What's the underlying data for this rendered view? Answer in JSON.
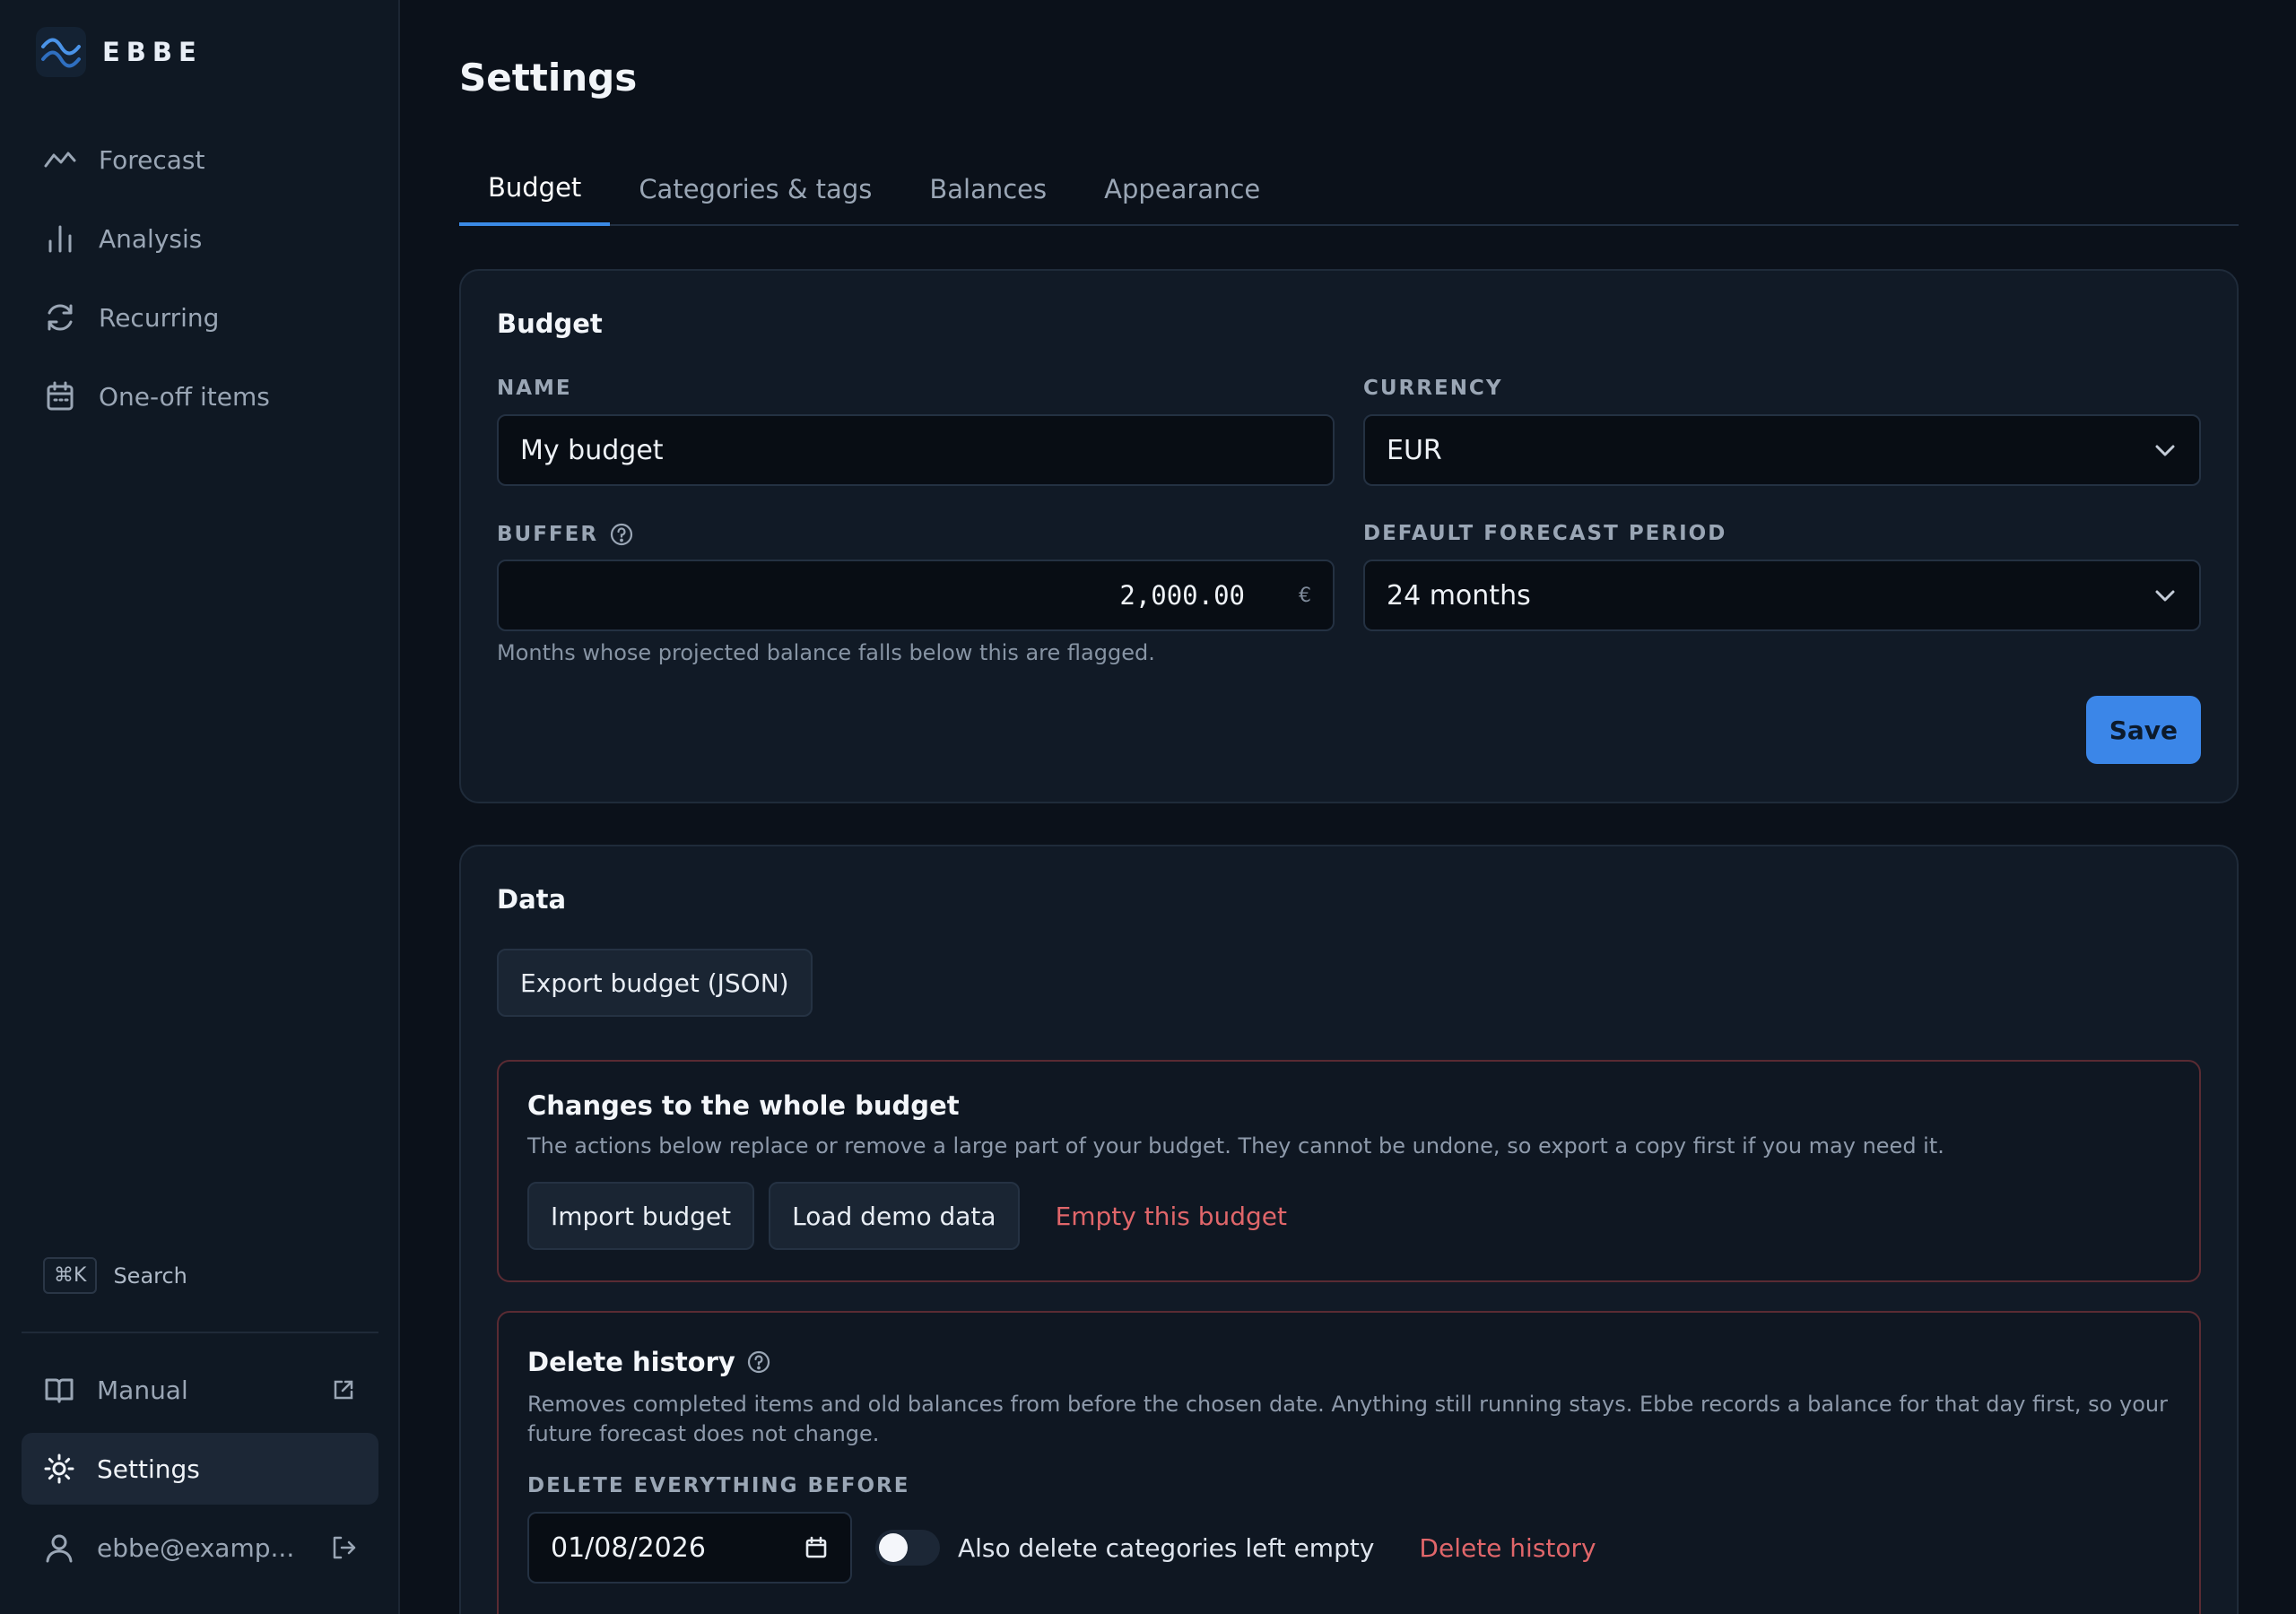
{
  "brand": {
    "name": "EBBE"
  },
  "nav": [
    {
      "label": "Forecast"
    },
    {
      "label": "Analysis"
    },
    {
      "label": "Recurring"
    },
    {
      "label": "One-off items"
    }
  ],
  "search": {
    "shortcut": "⌘K",
    "label": "Search"
  },
  "bottom_nav": {
    "manual": "Manual",
    "settings": "Settings",
    "account": "ebbe@examp..."
  },
  "page": {
    "title": "Settings"
  },
  "tabs": [
    {
      "label": "Budget",
      "active": true
    },
    {
      "label": "Categories & tags",
      "active": false
    },
    {
      "label": "Balances",
      "active": false
    },
    {
      "label": "Appearance",
      "active": false
    }
  ],
  "budget_card": {
    "title": "Budget",
    "name_label": "NAME",
    "name_value": "My budget",
    "currency_label": "CURRENCY",
    "currency_value": "EUR",
    "buffer_label": "BUFFER",
    "buffer_value": "2,000.00",
    "buffer_suffix": "€",
    "period_label": "DEFAULT FORECAST PERIOD",
    "period_value": "24 months",
    "buffer_hint": "Months whose projected balance falls below this are flagged.",
    "save_label": "Save"
  },
  "data_card": {
    "title": "Data",
    "export_label": "Export budget (JSON)",
    "whole": {
      "title": "Changes to the whole budget",
      "desc": "The actions below replace or remove a large part of your budget. They cannot be undone, so export a copy first if you may need it.",
      "import_label": "Import budget",
      "demo_label": "Load demo data",
      "empty_label": "Empty this budget"
    },
    "history": {
      "title": "Delete history",
      "desc": "Removes completed items and old balances from before the chosen date. Anything still running stays. Ebbe records a balance for that day first, so your future forecast does not change.",
      "date_label": "DELETE EVERYTHING BEFORE",
      "date_value": "01/08/2026",
      "toggle_label": "Also delete categories left empty",
      "toggle_on": false,
      "delete_label": "Delete history"
    }
  },
  "colors": {
    "accent": "#3b86e8",
    "danger": "#e0666a",
    "bg": "#0b111a",
    "sidebar": "#0f1823"
  }
}
